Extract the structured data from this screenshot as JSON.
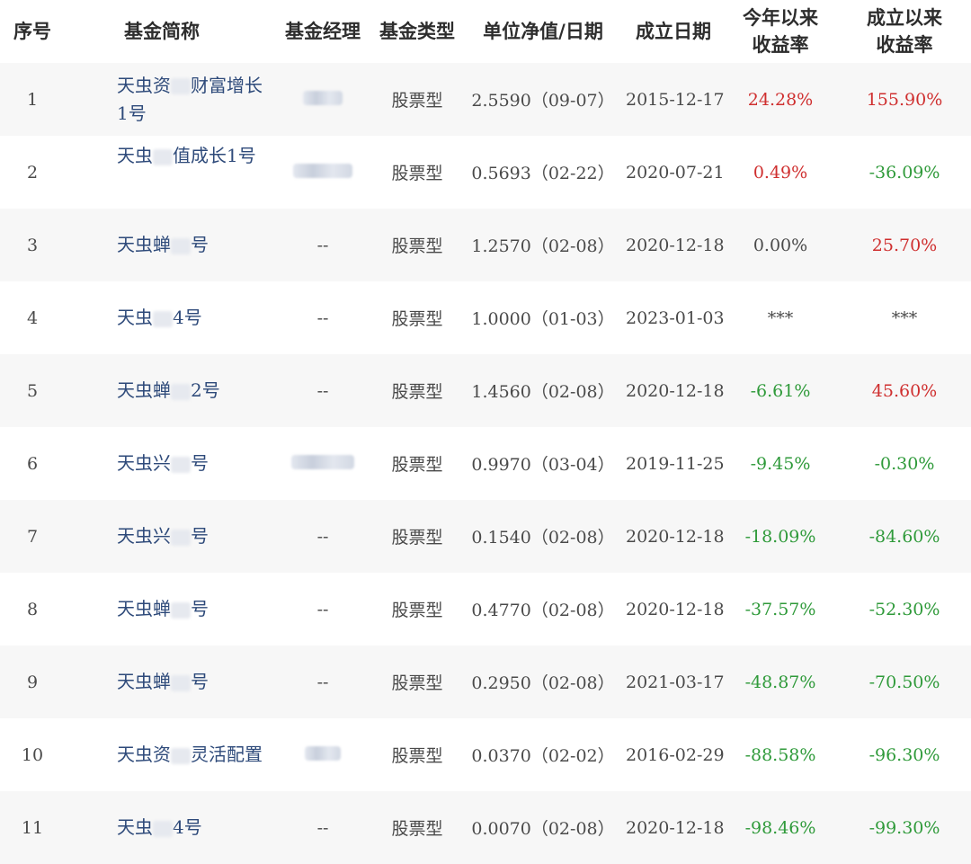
{
  "table": {
    "headers": [
      {
        "lines": [
          "序号"
        ]
      },
      {
        "lines": [
          "基金简称"
        ]
      },
      {
        "lines": [
          "基金经理"
        ]
      },
      {
        "lines": [
          "基金类型"
        ]
      },
      {
        "lines": [
          "单位净值/日期"
        ]
      },
      {
        "lines": [
          "成立日期"
        ]
      },
      {
        "lines": [
          "今年以来",
          "收益率"
        ]
      },
      {
        "lines": [
          "成立以来",
          "收益率"
        ]
      }
    ],
    "rows": [
      {
        "no": "1",
        "name_a": "天虫资",
        "name_b": "财富增长1号",
        "manager": "",
        "type": "股票型",
        "nav": "2.5590（09-07）",
        "founded": "2015-12-17",
        "ytd": "24.28%",
        "ytd_dir": "up",
        "since": "155.90%",
        "since_dir": "up",
        "mgr_blur": 44,
        "top": false
      },
      {
        "no": "2",
        "name_a": "天虫",
        "name_b": "值成长1号",
        "manager": "",
        "type": "股票型",
        "nav": "0.5693（02-22）",
        "founded": "2020-07-21",
        "ytd": "0.49%",
        "ytd_dir": "up",
        "since": "-36.09%",
        "since_dir": "down",
        "mgr_blur": 66,
        "top": true
      },
      {
        "no": "3",
        "name_a": "天虫蝉",
        "name_b": "号",
        "manager": "--",
        "type": "股票型",
        "nav": "1.2570（02-08）",
        "founded": "2020-12-18",
        "ytd": "0.00%",
        "ytd_dir": "flat",
        "since": "25.70%",
        "since_dir": "up",
        "mgr_blur": 0,
        "top": false
      },
      {
        "no": "4",
        "name_a": "天虫",
        "name_b": "4号",
        "manager": "--",
        "type": "股票型",
        "nav": "1.0000（01-03）",
        "founded": "2023-01-03",
        "ytd": "***",
        "ytd_dir": "flat",
        "since": "***",
        "since_dir": "flat",
        "mgr_blur": 0,
        "top": false
      },
      {
        "no": "5",
        "name_a": "天虫蝉",
        "name_b": "2号",
        "manager": "--",
        "type": "股票型",
        "nav": "1.4560（02-08）",
        "founded": "2020-12-18",
        "ytd": "-6.61%",
        "ytd_dir": "down",
        "since": "45.60%",
        "since_dir": "up",
        "mgr_blur": 0,
        "top": false
      },
      {
        "no": "6",
        "name_a": "天虫兴",
        "name_b": "号",
        "manager": "",
        "type": "股票型",
        "nav": "0.9970（03-04）",
        "founded": "2019-11-25",
        "ytd": "-9.45%",
        "ytd_dir": "down",
        "since": "-0.30%",
        "since_dir": "down",
        "mgr_blur": 70,
        "top": false
      },
      {
        "no": "7",
        "name_a": "天虫兴",
        "name_b": "号",
        "manager": "--",
        "type": "股票型",
        "nav": "0.1540（02-08）",
        "founded": "2020-12-18",
        "ytd": "-18.09%",
        "ytd_dir": "down",
        "since": "-84.60%",
        "since_dir": "down",
        "mgr_blur": 0,
        "top": false
      },
      {
        "no": "8",
        "name_a": "天虫蝉",
        "name_b": "号",
        "manager": "--",
        "type": "股票型",
        "nav": "0.4770（02-08）",
        "founded": "2020-12-18",
        "ytd": "-37.57%",
        "ytd_dir": "down",
        "since": "-52.30%",
        "since_dir": "down",
        "mgr_blur": 0,
        "top": false
      },
      {
        "no": "9",
        "name_a": "天虫蝉",
        "name_b": "号",
        "manager": "--",
        "type": "股票型",
        "nav": "0.2950（02-08）",
        "founded": "2021-03-17",
        "ytd": "-48.87%",
        "ytd_dir": "down",
        "since": "-70.50%",
        "since_dir": "down",
        "mgr_blur": 0,
        "top": false
      },
      {
        "no": "10",
        "name_a": "天虫资",
        "name_b": "灵活配置",
        "manager": "",
        "type": "股票型",
        "nav": "0.0370（02-02）",
        "founded": "2016-02-29",
        "ytd": "-88.58%",
        "ytd_dir": "down",
        "since": "-96.30%",
        "since_dir": "down",
        "mgr_blur": 40,
        "top": false
      },
      {
        "no": "11",
        "name_a": "天虫",
        "name_b": "4号",
        "manager": "--",
        "type": "股票型",
        "nav": "0.0070（02-08）",
        "founded": "2020-12-18",
        "ytd": "-98.46%",
        "ytd_dir": "down",
        "since": "-99.30%",
        "since_dir": "down",
        "mgr_blur": 0,
        "top": false
      }
    ]
  },
  "colors": {
    "up": "#cf2f2f",
    "down": "#2f9a3a",
    "name": "#2e4a7a",
    "stripe": "#f7f7f7"
  }
}
